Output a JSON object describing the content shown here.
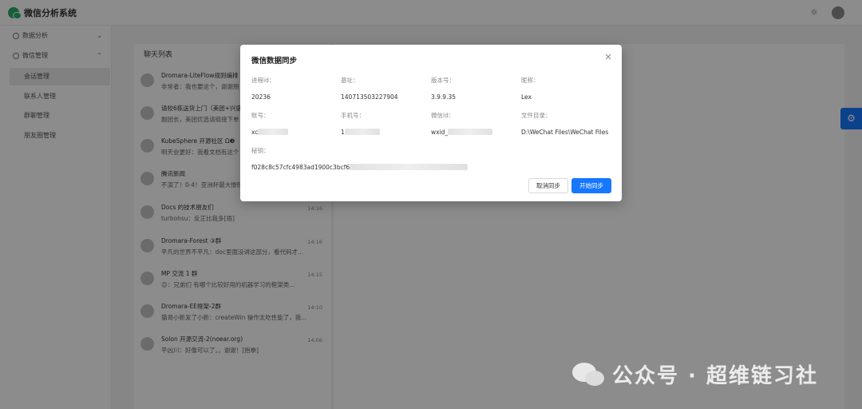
{
  "app": {
    "title": "微信分析系统"
  },
  "sidebar": {
    "menus": [
      {
        "label": "数据分析",
        "caret": "⌄"
      },
      {
        "label": "微信管理",
        "caret": "⌃"
      }
    ],
    "sub_items": [
      "会话管理",
      "联系人管理",
      "群聊管理",
      "朋友圈管理"
    ]
  },
  "chat_list": {
    "title": "聊天列表",
    "items": [
      {
        "name": "Dromara-LiteFlow规则编排",
        "msg": "非常者：我也要这个，谢谢朋",
        "time": ""
      },
      {
        "name": "请校6栋送货上门（美团+兴盛",
        "msg": "副团长，美团优选请链接下单",
        "time": ""
      },
      {
        "name": "KubeSphere 开源社区 Ω❸",
        "msg": "明天会更好：我看文档有这个",
        "time": ""
      },
      {
        "name": "腾讯新闻",
        "msg": "不演了！0-4！亚洲杯最大惨败",
        "time": ""
      },
      {
        "name": "Docs 的技术朋友们",
        "msg": "turbohsu：反正比我多[捂]",
        "time": "14:16"
      },
      {
        "name": "Dromara-Forest ③群",
        "msg": "平凡的世界不平凡：doc里面没讲这部分，看代码才...",
        "time": "14:16"
      },
      {
        "name": "MP 交流 1 群",
        "msg": "😊：兄弟们 有哪个比较好用的机器学习的框架类...",
        "time": "14:15"
      },
      {
        "name": "Dromara-EE框架-2群",
        "msg": "猫哥小新发了小新：createWin 操作太吃性能了，我...",
        "time": "14:10"
      },
      {
        "name": "Solon 开源交流-2(noear.org)",
        "msg": "平凶川：好像可以了。。谢谢！[抱拳]",
        "time": "14:06"
      }
    ]
  },
  "dialog": {
    "title": "微信数据同步",
    "close": "×",
    "fields": [
      {
        "label": "进程id：",
        "value": "20236"
      },
      {
        "label": "基址：",
        "value": "140713503227904"
      },
      {
        "label": "版本号：",
        "value": "3.9.9.35"
      },
      {
        "label": "昵称：",
        "value": "Lex"
      },
      {
        "label": "账号：",
        "value": "xc"
      },
      {
        "label": "手机号：",
        "value": "1"
      },
      {
        "label": "微信id：",
        "value": "wxid_"
      },
      {
        "label": "文件目录：",
        "value": "D:\\WeChat Files\\WeChat Files"
      },
      {
        "label": "秘钥：",
        "value": "f028c8c57cfc4983ad1900c3bcf6"
      }
    ],
    "cancel_label": "取消同步",
    "ok_label": "开始同步"
  },
  "watermark": {
    "text": "公众号 · 超维链习社"
  },
  "colors": {
    "primary": "#1677ff",
    "brand_green": "#2aae67"
  },
  "icons": {
    "settings": "gear-icon",
    "theme": "theme-icon",
    "user": "avatar"
  }
}
